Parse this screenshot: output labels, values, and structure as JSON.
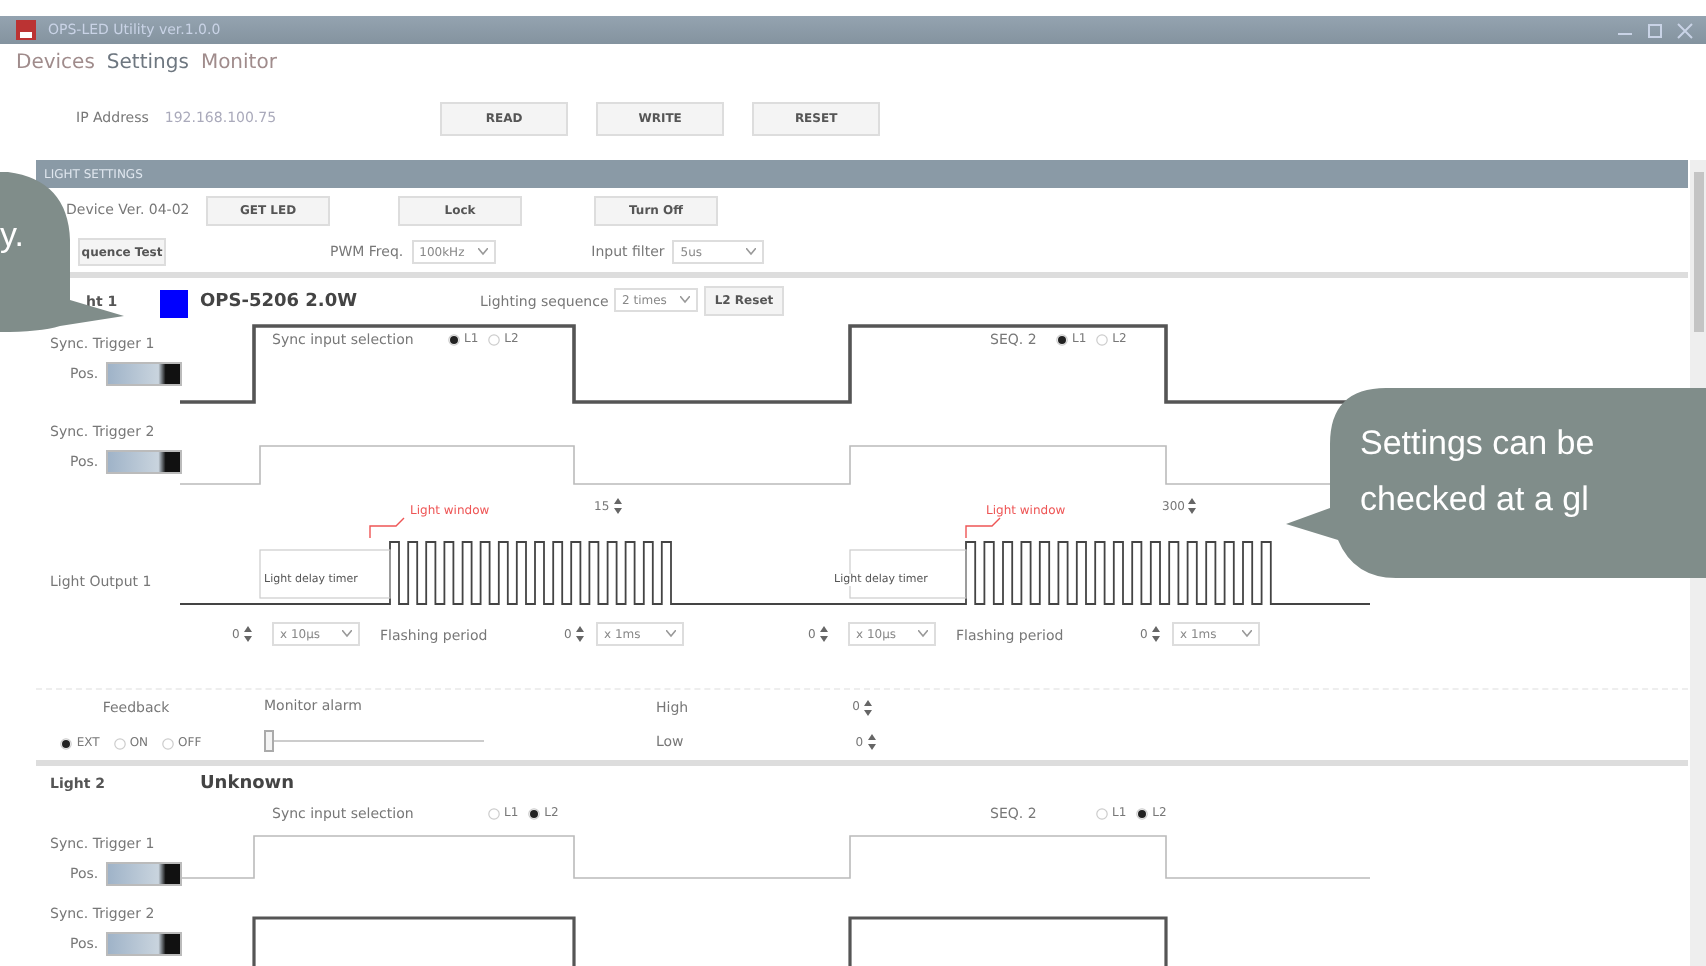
{
  "window": {
    "title": "OPS-LED Utility ver.1.0.0"
  },
  "menu": [
    {
      "label": "Devices",
      "selected": false
    },
    {
      "label": "Settings",
      "selected": true
    },
    {
      "label": "Monitor",
      "selected": false
    }
  ],
  "connection": {
    "ip_label": "IP Address",
    "ip_value": "192.168.100.75",
    "buttons": [
      "READ",
      "WRITE",
      "RESET"
    ]
  },
  "section_title": "LIGHT SETTINGS",
  "device": {
    "version": "Device Ver. 04-02",
    "buttons": [
      "GET LED",
      "Lock",
      "Turn Off"
    ]
  },
  "test": {
    "button": "quence Test",
    "pwm_label": "PWM Freq.",
    "pwm_value": "100kHz",
    "filter_label": "Input filter",
    "filter_value": "5us"
  },
  "lights": [
    {
      "label": "ht 1",
      "color": "#0000ff",
      "model": "OPS-5206 2.0W",
      "sequence_label": "Lighting sequence",
      "sequence_value": "2 times",
      "reset": "L2 Reset",
      "sync_label": "Sync input selection",
      "sync_options": [
        {
          "label": "L1",
          "selected": true
        },
        {
          "label": "L2",
          "selected": false
        }
      ],
      "seq2_label": "SEQ. 2",
      "seq2_options": [
        {
          "label": "L1",
          "selected": true
        },
        {
          "label": "L2",
          "selected": false
        }
      ],
      "triggers": [
        {
          "label": "Sync. Trigger 1",
          "pos": "Pos."
        },
        {
          "label": "Sync. Trigger 2",
          "pos": "Pos."
        }
      ],
      "output_label": "Light Output 1",
      "windows": [
        {
          "label": "Light window",
          "value": "15",
          "delay_label": "Light delay timer",
          "delay_value": "0",
          "delay_unit": "x 10µs",
          "period_label": "Flashing period",
          "period_value": "0",
          "period_unit": "x 1ms"
        },
        {
          "label": "Light window",
          "value": "300",
          "delay_label": "Light delay timer",
          "delay_value": "0",
          "delay_unit": "x 10µs",
          "period_label": "Flashing period",
          "period_value": "0",
          "period_unit": "x 1ms"
        }
      ],
      "feedback": {
        "label": "Feedback",
        "options": [
          {
            "label": "EXT",
            "selected": true
          },
          {
            "label": "ON",
            "selected": false
          },
          {
            "label": "OFF",
            "selected": false
          }
        ],
        "alarm_label": "Monitor alarm",
        "level": 0,
        "high_label": "High",
        "high_value": "0",
        "low_label": "Low",
        "low_value": "0"
      }
    },
    {
      "label": "Light 2",
      "model": "Unknown",
      "sync_label": "Sync input selection",
      "sync_options": [
        {
          "label": "L1",
          "selected": false
        },
        {
          "label": "L2",
          "selected": true
        }
      ],
      "seq2_label": "SEQ. 2",
      "seq2_options": [
        {
          "label": "L1",
          "selected": false
        },
        {
          "label": "L2",
          "selected": true
        }
      ],
      "triggers": [
        {
          "label": "Sync. Trigger 1",
          "pos": "Pos."
        },
        {
          "label": "Sync. Trigger 2",
          "pos": "Pos."
        }
      ]
    }
  ],
  "callouts": [
    {
      "lines": [
        "y."
      ]
    },
    {
      "lines": [
        "Settings can be",
        "checked at a gl"
      ]
    }
  ]
}
